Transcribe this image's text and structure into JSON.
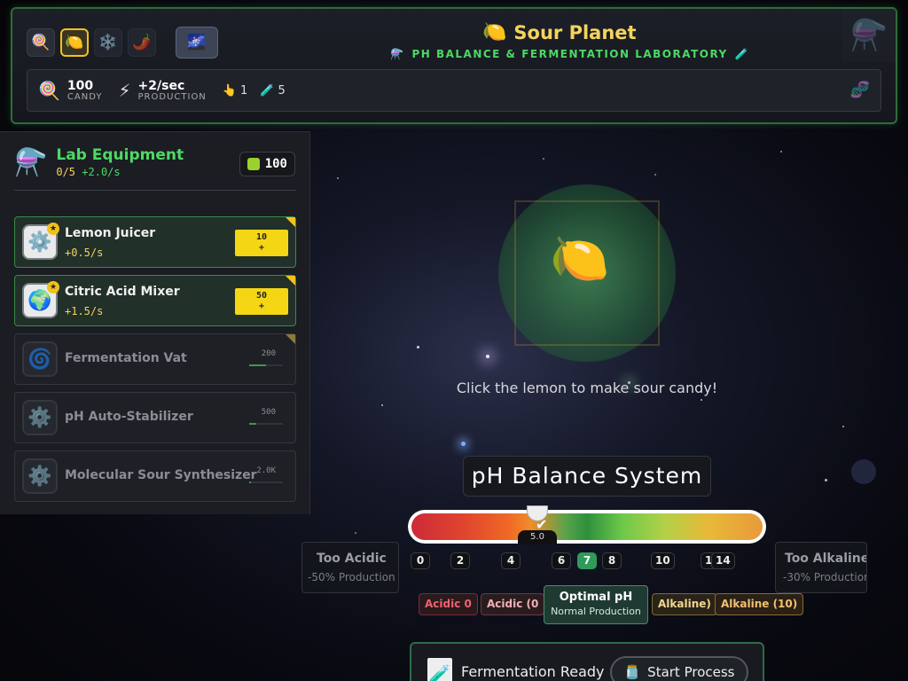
{
  "header": {
    "planet_buttons": [
      {
        "icon": "🍭",
        "name": "candy-planet"
      },
      {
        "icon": "🍋",
        "name": "sour-planet"
      },
      {
        "icon": "❄️",
        "name": "ice-planet"
      },
      {
        "icon": "🌶️",
        "name": "spicy-planet"
      }
    ],
    "galaxy_icon": "🌌",
    "title_icon": "🍋",
    "title": "Sour Planet",
    "subtitle_icon_left": "⚗️",
    "subtitle": "PH BALANCE & FERMENTATION LABORATORY",
    "subtitle_icon_right": "🧪",
    "corner_icon": "⚗️"
  },
  "stats": {
    "candy_icon": "🍭",
    "candy_value": "100",
    "candy_label": "CANDY",
    "production_icon": "⚡",
    "production_value": "+2/sec",
    "production_label": "PRODUCTION",
    "click_icon": "👆",
    "click_value": "1",
    "tube_icon": "🧪",
    "tube_value": "5",
    "dna_icon": "🧬"
  },
  "sidebar": {
    "icon": "⚗️",
    "title": "Lab Equipment",
    "owned": "0/5",
    "rate": "+2.0/s",
    "candy_count": "100",
    "items": [
      {
        "icon": "⚙️",
        "name": "Lemon Juicer",
        "rate": "+0.5/s",
        "cost": "10",
        "buy_suffix": "+"
      },
      {
        "icon": "🌍",
        "name": "Citric Acid Mixer",
        "rate": "+1.5/s",
        "cost": "50",
        "buy_suffix": "+"
      },
      {
        "icon": "🌀",
        "name": "Fermentation Vat",
        "cost": "200",
        "progress": 0.5
      },
      {
        "icon": "⚙️",
        "name": "pH Auto-Stabilizer",
        "cost": "500",
        "progress": 0.2
      },
      {
        "icon": "⚙️",
        "name": "Molecular Sour Synthesizer",
        "cost": "2.0K",
        "progress": 0.05
      }
    ]
  },
  "center": {
    "lemon_icon": "🍋",
    "click_hint": "Click the lemon to make sour candy!"
  },
  "ph": {
    "title": "pH Balance System",
    "current_value": "5.0",
    "check_icon": "✔",
    "ticks": [
      "0",
      "2",
      "4",
      "6",
      "7",
      "8",
      "10",
      "1",
      "14"
    ],
    "active_tick": "7",
    "too_acidic": {
      "title": "Too Acidic",
      "sub": "-50% Production"
    },
    "too_alkaline": {
      "title": "Too Alkaline",
      "sub": "-30% Production"
    },
    "zones": {
      "acidic_0": "Acidic 0",
      "acidic_0b": "Acidic (0",
      "optimal_title": "Optimal pH",
      "optimal_sub": "Normal Production",
      "alkaline": "Alkaline)",
      "alkaline_10": "Alkaline (10)"
    }
  },
  "fermentation": {
    "icon": "🧪",
    "label": "Fermentation Ready",
    "button_icon": "🫙",
    "button_label": "Start Process"
  },
  "colors": {
    "accent_green": "#4cd964",
    "accent_yellow": "#f4d35e",
    "buy_yellow": "#f4d614"
  }
}
